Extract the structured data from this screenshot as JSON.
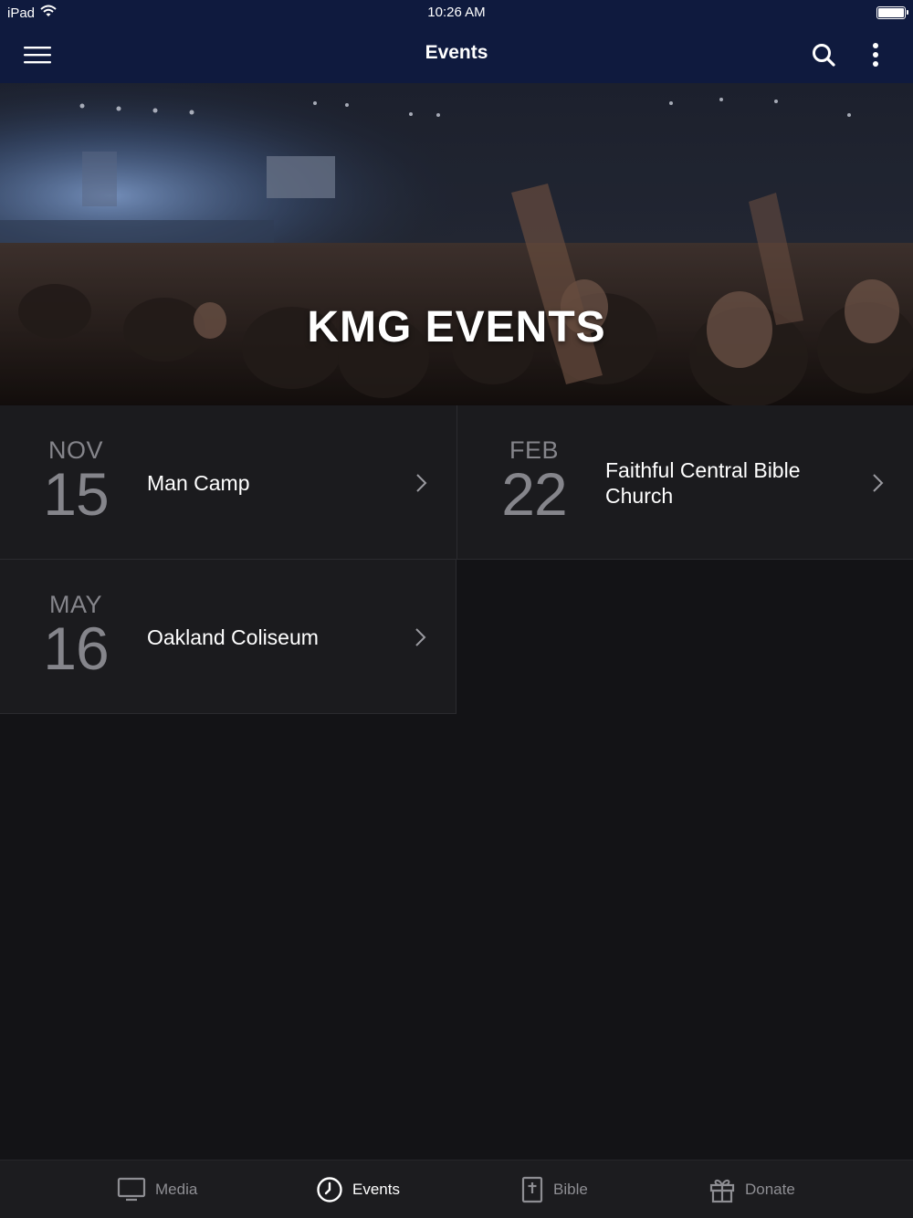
{
  "status_bar": {
    "device": "iPad",
    "time": "10:26 AM"
  },
  "nav": {
    "title": "Events"
  },
  "hero": {
    "title": "KMG EVENTS"
  },
  "events": [
    {
      "month": "NOV",
      "day": "15",
      "name": "Man Camp"
    },
    {
      "month": "FEB",
      "day": "22",
      "name": "Faithful Central Bible Church"
    },
    {
      "month": "MAY",
      "day": "16",
      "name": "Oakland Coliseum"
    }
  ],
  "tabs": [
    {
      "label": "Media",
      "icon": "monitor-icon"
    },
    {
      "label": "Events",
      "icon": "clock-icon",
      "active": true
    },
    {
      "label": "Bible",
      "icon": "bible-icon"
    },
    {
      "label": "Donate",
      "icon": "gift-icon"
    }
  ],
  "colors": {
    "nav_background": "#0f1a3e",
    "page_background": "#131316",
    "card_background": "#1b1b1e",
    "muted_text": "#85858b"
  }
}
